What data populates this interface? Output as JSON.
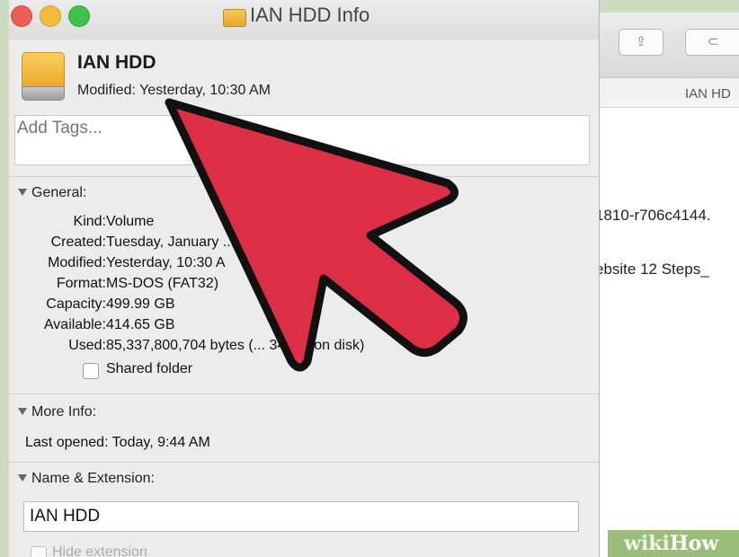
{
  "background_window": {
    "pathbar_text": "IAN HD",
    "line1": "1810-r706c4144.",
    "line2": "ebsite  12 Steps_",
    "line3": "/"
  },
  "window": {
    "title": "IAN HDD Info"
  },
  "header": {
    "drive_name": "IAN HDD",
    "modified": "Modified: Yesterday, 10:30 AM"
  },
  "tags": {
    "placeholder": "Add Tags..."
  },
  "general": {
    "heading": "General:",
    "rows": [
      {
        "label": "Kind:",
        "value": "Volume"
      },
      {
        "label": "Created:",
        "value": "Tuesday, January ... M"
      },
      {
        "label": "Modified:",
        "value": "Yesterday, 10:30 A"
      },
      {
        "label": "Format:",
        "value": "MS-DOS (FAT32)"
      },
      {
        "label": "Capacity:",
        "value": "499.99 GB"
      },
      {
        "label": "Available:",
        "value": "414.65 GB"
      },
      {
        "label": "Used:",
        "value": "85,337,800,704 bytes (... 34 GB on disk)"
      }
    ],
    "shared_folder_label": "Shared folder"
  },
  "more_info": {
    "heading": "More Info:",
    "last_opened": "Last opened: Today, 9:44 AM"
  },
  "name_extension": {
    "heading": "Name & Extension:",
    "name_value": "IAN HDD",
    "hide_extension_label": "Hide extension"
  },
  "watermark": {
    "wiki": "wiki",
    "how": "How"
  },
  "colors": {
    "arrow_fill": "#dc2e45",
    "traffic_close": "#ec5f56",
    "traffic_min": "#f3bb3c",
    "traffic_max": "#3fc24c"
  }
}
